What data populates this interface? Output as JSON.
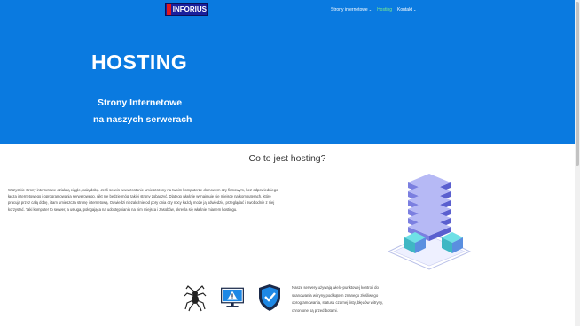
{
  "header": {
    "logo_text": "INFORIUS",
    "nav": [
      {
        "label": "Strony internetowe",
        "has_dropdown": true,
        "active": false
      },
      {
        "label": "Hosting",
        "has_dropdown": false,
        "active": true
      },
      {
        "label": "Kontakt",
        "has_dropdown": true,
        "active": false
      }
    ],
    "dropdown_glyph": "⌄"
  },
  "hero": {
    "title": "HOSTING",
    "subtitle_line1": "Strony Internetowe",
    "subtitle_line2": "na naszych serwerach"
  },
  "main": {
    "section_title": "Co to jest hosting?",
    "description": "Wszystkie strony internetowe działają ciągle, całą dobę. Jeśli serwis www zostanie umieszczony na twoim komputerze domowym czy firmowym, bez odpowiedniego łącza internetowego i oprogramowania serwerowego, nikt nie będzie mógł takiej strony zobaczyć. Dlatego właśnie wynajmuje się miejsce na komputerach, które pracują przez całą dobę, i tam umieszcza stronę internetową. Odwiedzi niezależnie od pory dnia czy nocy każdy może ją odwiedzić, przeglądać i swobodnie z niej korzystać. Taki komputer to serwer, a usługa, polegająca na udostępnianiu na nim miejsca i zasobów, określa się właśnie mianem hostingu.",
    "features_text": "Nasze serwery używają wielo-punktowej kontroli do skanowania witryny pod kątem znanego złośliwego oprogramowania, statusu czarnej listy, błędów witryny, chronione są przed botami."
  },
  "icons": [
    "spider-icon",
    "monitor-warning-icon",
    "shield-check-icon",
    "server-stack-icon"
  ],
  "colors": {
    "hero_bg": "#0a7ae0",
    "nav_active": "#7ff08a",
    "logo_bg": "#1a1f9c",
    "logo_mark": "#e0171f"
  }
}
